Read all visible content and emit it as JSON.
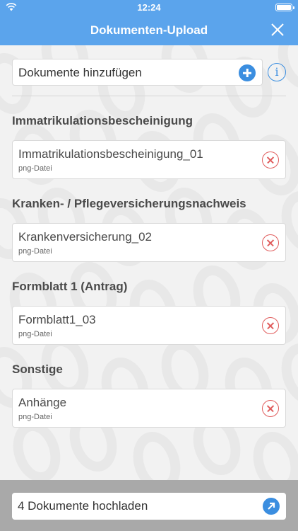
{
  "status_bar": {
    "time": "12:24"
  },
  "nav": {
    "title": "Dokumenten-Upload",
    "close_icon": "close-icon"
  },
  "add_documents": {
    "label": "Dokumente hinzufügen",
    "add_icon": "plus-circle-icon",
    "info_icon": "info-icon",
    "info_glyph": "i"
  },
  "sections": [
    {
      "title": "Immatrikulationsbescheinigung",
      "file": {
        "name": "Immatrikulationsbescheinigung_01",
        "type": "png-Datei"
      }
    },
    {
      "title": "Kranken- / Pflegeversicherungsnachweis",
      "file": {
        "name": "Krankenversicherung_02",
        "type": "png-Datei"
      }
    },
    {
      "title": "Formblatt 1 (Antrag)",
      "file": {
        "name": "Formblatt1_03",
        "type": "png-Datei"
      }
    },
    {
      "title": "Sonstige",
      "file": {
        "name": "Anhänge",
        "type": "png-Datei"
      }
    }
  ],
  "upload": {
    "label": "4 Dokumente hochladen",
    "icon": "upload-arrow-icon"
  },
  "colors": {
    "accent": "#5ba4ec",
    "button_blue": "#3b8ee0",
    "remove_red": "#e05c5c",
    "bottom_bar": "#a9a9a9"
  }
}
